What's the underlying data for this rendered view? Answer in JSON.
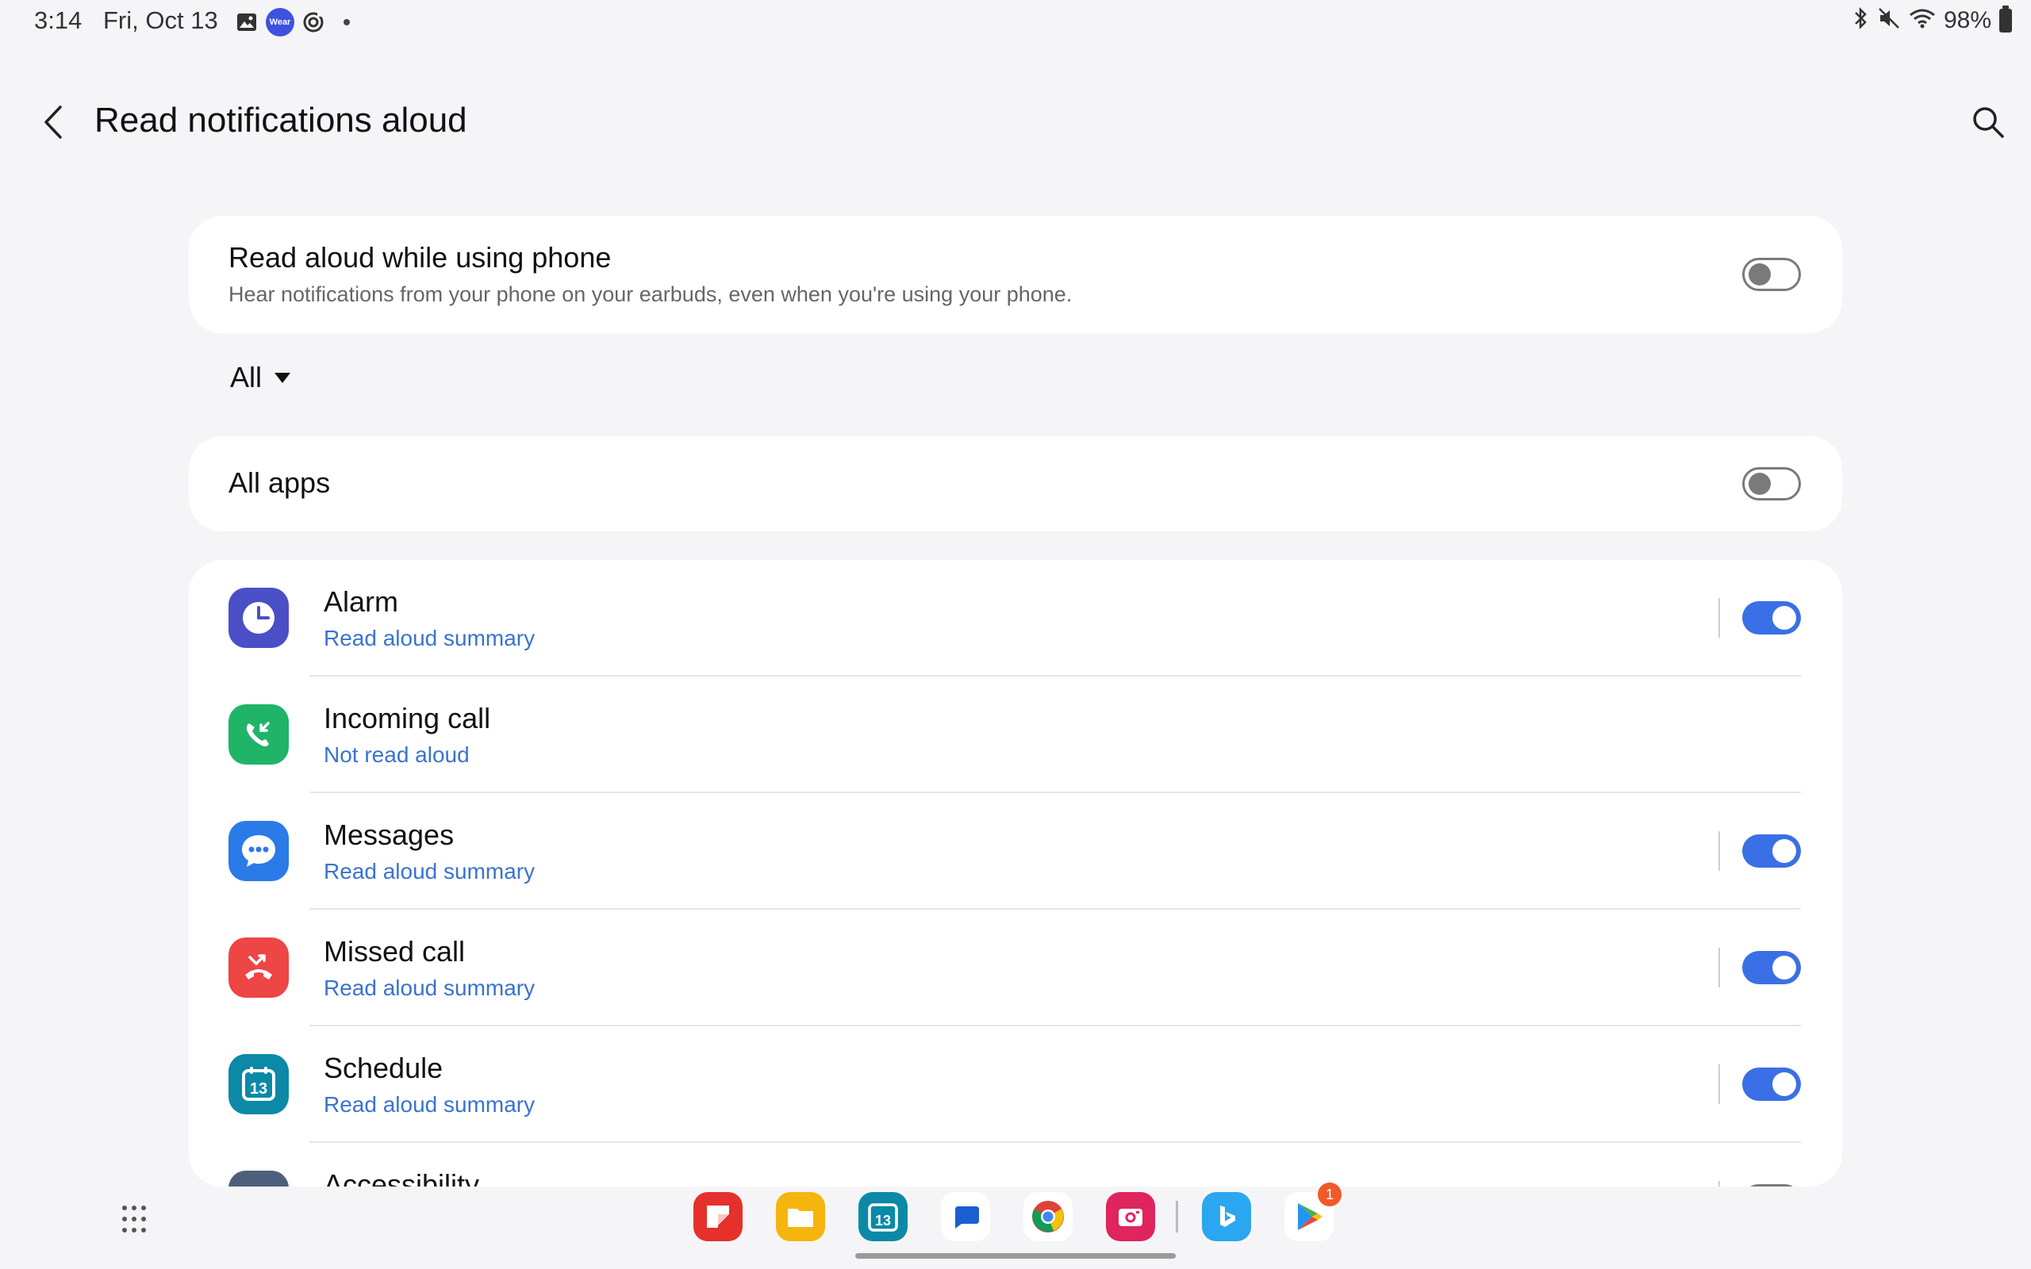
{
  "status_bar": {
    "time": "3:14",
    "date": "Fri, Oct 13",
    "wear_label": "Wear",
    "battery": "98%",
    "icons": [
      "gallery-icon",
      "galaxy-wearable-icon",
      "sync-icon",
      "bluetooth-icon",
      "mute-icon",
      "wifi-icon",
      "battery-icon"
    ]
  },
  "header": {
    "title": "Read notifications aloud"
  },
  "phone_setting": {
    "title": "Read aloud while using phone",
    "subtitle": "Hear notifications from your phone on your earbuds, even when you're using your phone.",
    "enabled": false
  },
  "filter": {
    "selected": "All"
  },
  "all_apps": {
    "label": "All apps",
    "enabled": false
  },
  "apps": [
    {
      "name": "Alarm",
      "status": "Read aloud summary",
      "enabled": true,
      "has_toggle": true,
      "icon": "alarm-icon",
      "color": "#4b4fc6"
    },
    {
      "name": "Incoming call",
      "status": "Not read aloud",
      "enabled": false,
      "has_toggle": false,
      "icon": "incoming-call-icon",
      "color": "#1fb468"
    },
    {
      "name": "Messages",
      "status": "Read aloud summary",
      "enabled": true,
      "has_toggle": true,
      "icon": "messages-icon",
      "color": "#2a7ae8"
    },
    {
      "name": "Missed call",
      "status": "Read aloud summary",
      "enabled": true,
      "has_toggle": true,
      "icon": "missed-call-icon",
      "color": "#ee4545"
    },
    {
      "name": "Schedule",
      "status": "Read aloud summary",
      "enabled": true,
      "has_toggle": true,
      "icon": "calendar-icon",
      "color": "#0b89a6"
    },
    {
      "name": "Accessibility",
      "status": "",
      "enabled": false,
      "has_toggle": true,
      "icon": "accessibility-icon",
      "color": "#4d5f7a"
    }
  ],
  "dock": {
    "calendar_day": "13",
    "play_store_badge": "1",
    "apps": [
      "flipboard-icon",
      "my-files-icon",
      "calendar-icon",
      "messages-icon",
      "chrome-icon",
      "camera-icon",
      "bing-icon",
      "play-store-icon"
    ]
  },
  "colors": {
    "accent": "#3b6fe5",
    "link": "#3a72d1",
    "background": "#f5f5f7"
  }
}
